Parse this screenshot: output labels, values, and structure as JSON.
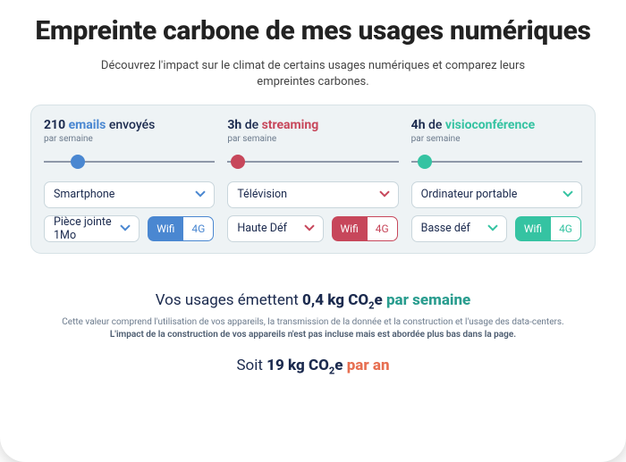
{
  "title": "Empreinte carbone de mes usages numériques",
  "subtitle": "Découvrez l'impact sur le climat de certains usages numériques et comparez leurs empreintes carbones.",
  "per_week_label": "par semaine",
  "toggle": {
    "wifi": "Wifi",
    "fourg": "4G"
  },
  "emails": {
    "count": "210",
    "word": "emails",
    "suffix": "envoyés",
    "device": "Smartphone",
    "attachment": "Pièce jointe 1Mo",
    "network_active": "wifi",
    "chev_color": "#4a87d1"
  },
  "streaming": {
    "count": "3h",
    "prefix": "de",
    "word": "streaming",
    "device": "Télévision",
    "quality": "Haute Déf",
    "network_active": "wifi",
    "chev_color": "#c7475b"
  },
  "visio": {
    "count": "4h",
    "prefix": "de",
    "word": "visioconférence",
    "device": "Ordinateur portable",
    "quality": "Basse déf",
    "network_active": "wifi",
    "chev_color": "#35c3a2"
  },
  "result_week": {
    "prefix": "Vos usages émettent",
    "value": "0,4 kg CO",
    "sub": "2",
    "unit_suffix": "e",
    "period": "par semaine"
  },
  "disclaimer_line1": "Cette valeur comprend l'utilisation de vos appareils, la transmission de la donnée et la construction et l'usage des data-centers.",
  "disclaimer_line2": "L'impact de la construction de vos appareils n'est pas incluse mais est abordée plus bas dans la page.",
  "result_year": {
    "prefix": "Soit",
    "value": "19 kg CO",
    "sub": "2",
    "unit_suffix": "e",
    "period": "par an"
  }
}
